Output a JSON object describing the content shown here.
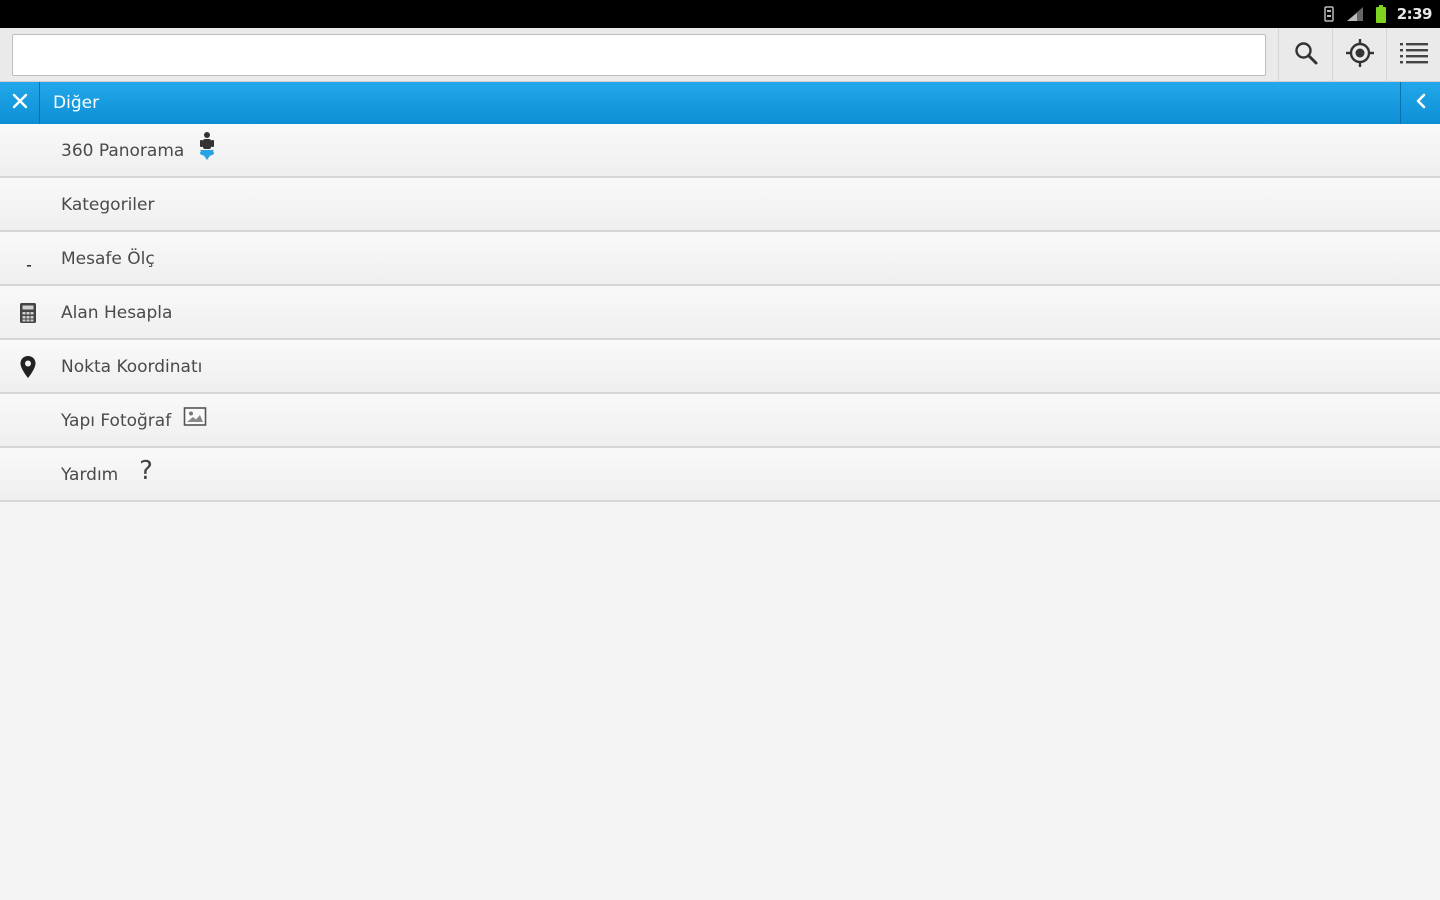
{
  "status_bar": {
    "time": "2:39",
    "icons": [
      "usb-debug-icon",
      "signal-icon",
      "battery-icon"
    ]
  },
  "toolbar": {
    "search_value": "",
    "search_placeholder": "",
    "buttons": [
      "search-icon",
      "locate-icon",
      "list-menu-icon"
    ]
  },
  "header": {
    "title": "Diğer",
    "close_icon": "close-icon",
    "back_icon": "chevron-left-icon"
  },
  "menu": {
    "items": [
      {
        "label": "360 Panorama",
        "trailing_icon": "pegman-icon"
      },
      {
        "label": "Kategoriler"
      },
      {
        "label": "Mesafe Ölç",
        "leading_icon": "ruler-icon"
      },
      {
        "label": "Alan Hesapla",
        "leading_icon": "calculator-icon"
      },
      {
        "label": "Nokta Koordinatı",
        "leading_icon": "location-pin-icon"
      },
      {
        "label": "Yapı Fotoğraf",
        "trailing_icon": "image-icon"
      },
      {
        "label": "Yardım",
        "trailing_icon": "question-icon",
        "trailing_glyph": "?"
      }
    ]
  },
  "colors": {
    "header_blue": "#1a9ee2",
    "pegman_blue": "#29a3e6",
    "background": "#f4f4f4"
  }
}
